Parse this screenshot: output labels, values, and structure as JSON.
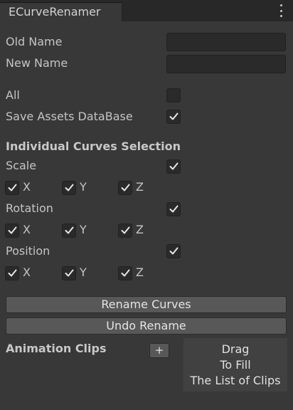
{
  "window": {
    "tab_title": "ECurveRenamer"
  },
  "fields": {
    "old_name": {
      "label": "Old Name",
      "value": ""
    },
    "new_name": {
      "label": "New Name",
      "value": ""
    }
  },
  "options": {
    "all": {
      "label": "All",
      "checked": false
    },
    "save_assets": {
      "label": "Save Assets DataBase",
      "checked": true
    }
  },
  "section_title": "Individual Curves Selection",
  "groups": {
    "scale": {
      "label": "Scale",
      "checked": true,
      "x": "X",
      "y": "Y",
      "z": "Z"
    },
    "rotation": {
      "label": "Rotation",
      "checked": true,
      "x": "X",
      "y": "Y",
      "z": "Z"
    },
    "position": {
      "label": "Position",
      "checked": true,
      "x": "X",
      "y": "Y",
      "z": "Z"
    }
  },
  "buttons": {
    "rename": "Rename Curves",
    "undo": "Undo Rename",
    "add": "+"
  },
  "clips": {
    "label": "Animation Clips",
    "drop_lines": [
      "Drag",
      "To Fill",
      "The List of Clips"
    ]
  },
  "colors": {
    "background": "#383838",
    "field": "#2a2a2a",
    "button": "#585858",
    "text": "#c4c4c4"
  },
  "icons": {
    "menu": "kebab-menu-icon",
    "check": "checkmark-icon"
  }
}
